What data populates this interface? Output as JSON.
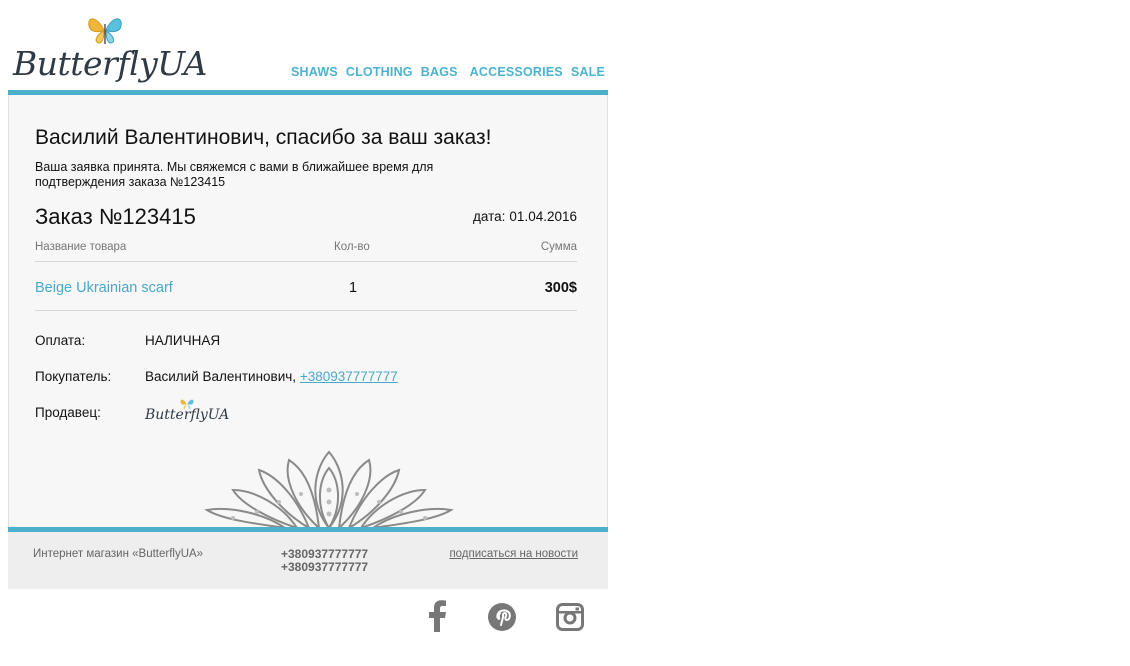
{
  "brand": {
    "name": "ButterflyUA"
  },
  "nav": [
    "SHAWS",
    "CLOTHING",
    "BAGS",
    "ACCESSORIES",
    "SALE"
  ],
  "main": {
    "title": "Василий Валентинович, спасибо за ваш заказ!",
    "subtitle": "Ваша заявка принята. Мы свяжемся с вами в ближайшее время для подтверждения заказа №123415",
    "order_number": "Заказ №123415",
    "date_label": "дата:",
    "date_value": "01.04.2016",
    "table": {
      "headers": {
        "name": "Название товара",
        "qty": "Кол-во",
        "sum": "Сумма"
      },
      "rows": [
        {
          "name": "Beige Ukrainian scarf",
          "qty": "1",
          "sum": "300$"
        }
      ]
    },
    "payment": {
      "label": "Оплата:",
      "value": "НАЛИЧНАЯ"
    },
    "buyer": {
      "label": "Покупатель:",
      "name": "Василий Валентинович,",
      "phone": "+380937777777"
    },
    "seller": {
      "label": "Продавец:"
    }
  },
  "footer": {
    "shop": "Интернет магазин «ButterflyUA»",
    "phones": [
      "+380937777777",
      "+380937777777"
    ],
    "subscribe": "подписаться на новости"
  },
  "colors": {
    "accent": "#4cb0cd",
    "link": "#4aa8c8",
    "panel": "#f7f7f7",
    "footer": "#eeeeee",
    "icons": "#777777"
  },
  "social": [
    "facebook-icon",
    "pinterest-icon",
    "instagram-icon"
  ]
}
